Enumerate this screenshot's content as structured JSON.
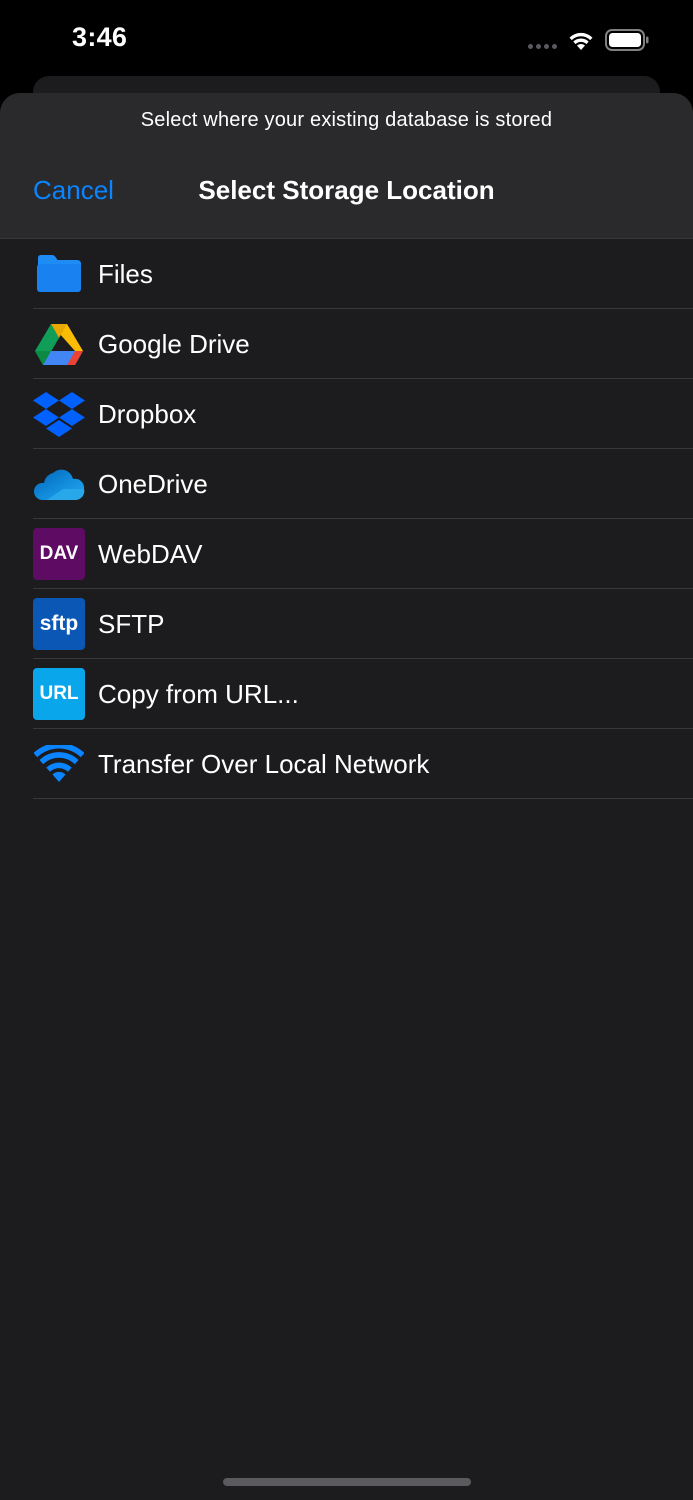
{
  "status_bar": {
    "time": "3:46"
  },
  "sheet": {
    "prompt": "Select where your existing database is stored",
    "cancel_label": "Cancel",
    "title": "Select Storage Location"
  },
  "locations": [
    {
      "label": "Files",
      "icon": "folder-icon"
    },
    {
      "label": "Google Drive",
      "icon": "google-drive-icon"
    },
    {
      "label": "Dropbox",
      "icon": "dropbox-icon"
    },
    {
      "label": "OneDrive",
      "icon": "onedrive-icon"
    },
    {
      "label": "WebDAV",
      "icon": "webdav-icon",
      "badge_text": "DAV"
    },
    {
      "label": "SFTP",
      "icon": "sftp-icon",
      "badge_text": "sftp"
    },
    {
      "label": "Copy from URL...",
      "icon": "url-icon",
      "badge_text": "URL"
    },
    {
      "label": "Transfer Over Local Network",
      "icon": "wifi-icon"
    }
  ],
  "colors": {
    "accent": "#0a84ff",
    "background": "#1c1c1e",
    "webdav": "#5e0b63",
    "sftp": "#0b57b5",
    "url": "#0aa6ec"
  }
}
